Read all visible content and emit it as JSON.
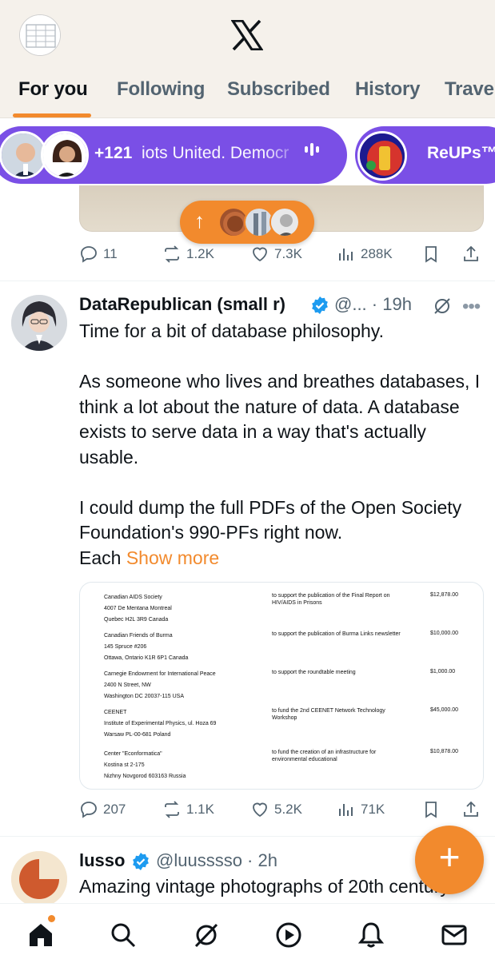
{
  "header": {
    "logo": "x-logo",
    "tabs": [
      {
        "label": "For you",
        "active": true
      },
      {
        "label": "Following",
        "active": false
      },
      {
        "label": "Subscribed",
        "active": false
      },
      {
        "label": "History",
        "active": false
      },
      {
        "label": "Trave",
        "active": false
      }
    ],
    "accent_color": "#f28a2d"
  },
  "spaces": {
    "count": "+121",
    "title": "iots United. Democr",
    "menu_glyph": "•••",
    "second_title": "ReUPs™",
    "color": "#7a4fe6"
  },
  "new_posts_button": {
    "arrow": "↑"
  },
  "tweet1": {
    "replies": "11",
    "reposts": "1.2K",
    "likes": "7.3K",
    "views": "288K"
  },
  "tweet2": {
    "name": "DataRepublican (small r)",
    "handle": "@...",
    "time": "19h",
    "paragraphs": [
      "Time for a bit of database philosophy.",
      "As someone who lives and breathes databases, I think a lot about the nature of data. A database exists to serve data in a way that's actually usable.",
      "I could dump the full PDFs of the Open Society Foundation's 990-PFs right now."
    ],
    "truncated_tail": "Each",
    "show_more": "Show more",
    "document_rows": [
      {
        "org": [
          "Canadian AIDS Society",
          "4007 De Mentana Montreal",
          "Quebec    H2L 3R9    Canada"
        ],
        "purpose": "to support the publication of the Final Report on HIV/AIDS in Prisons",
        "amount": "$12,878.00"
      },
      {
        "org": [
          "Canadian Friends of Burma",
          "145 Spruce #206",
          "Ottawa, Ontario    K1R 6P1    Canada"
        ],
        "purpose": "to support the publication of Burma Links newsletter",
        "amount": "$10,000.00"
      },
      {
        "org": [
          "Carnegie Endowment for International Peace",
          "2400 N Street, NW",
          "Washington DC    20037-115  USA"
        ],
        "purpose": "to support the roundtable meeting",
        "amount": "$1,000.00"
      },
      {
        "org": [
          "CEENET",
          "Institute of Experimental Physics, ul. Hoza 69",
          "Warsaw    PL-00-681   Poland"
        ],
        "purpose": "to fund the 2nd CEENET Network Technology Workshop",
        "amount": "$45,000.00"
      },
      {
        "org": [
          "Center \"Econformatica\"",
          "Kostina st 2-175",
          "Nizhny Novgorod    603163    Russia"
        ],
        "purpose": "to fund the creation of an infrastructure for environmental educational",
        "amount": "$10,878.00"
      }
    ],
    "replies": "207",
    "reposts": "1.1K",
    "likes": "5.2K",
    "views": "71K"
  },
  "tweet3": {
    "name": "lusso",
    "handle": "@luusssso",
    "time": "2h",
    "text": "Amazing vintage photographs of 20th century"
  },
  "fab": {
    "label": "+"
  },
  "bottom_nav": [
    "home-icon",
    "search-icon",
    "grok-icon",
    "video-icon",
    "notifications-icon",
    "messages-icon"
  ]
}
